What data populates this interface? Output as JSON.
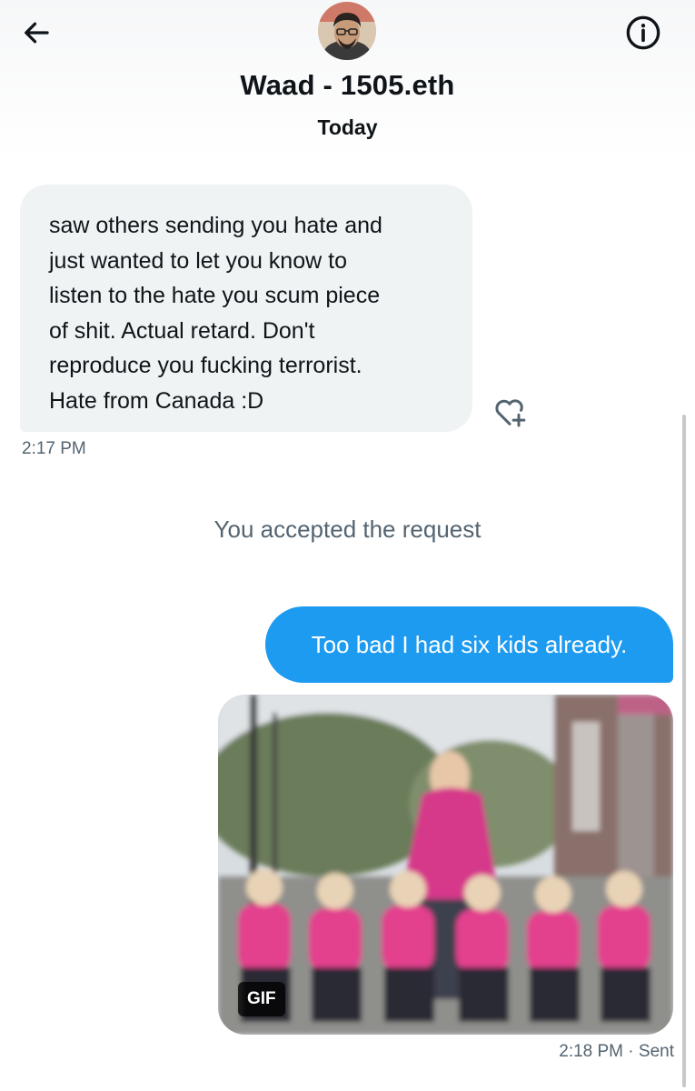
{
  "header": {
    "back_icon": "arrow-left-icon",
    "info_icon": "info-circle-icon",
    "contact_name": "Waad - 1505.eth",
    "date": "Today"
  },
  "messages": {
    "incoming": {
      "text": "saw others sending you hate and\njust wanted to let you know to\nlisten to the hate you scum piece\nof shit. Actual retard. Don't\nreproduce you fucking terrorist.\nHate from Canada :D",
      "time": "2:17 PM",
      "react_icon": "heart-plus-icon"
    },
    "system": "You accepted the request",
    "outgoing": {
      "text": "Too bad I had six kids already.",
      "gif_label": "GIF",
      "time": "2:18 PM",
      "status": "· Sent"
    }
  },
  "colors": {
    "accent": "#1d9bf0",
    "incoming_bubble": "#eff3f4",
    "muted_text": "#536471"
  }
}
